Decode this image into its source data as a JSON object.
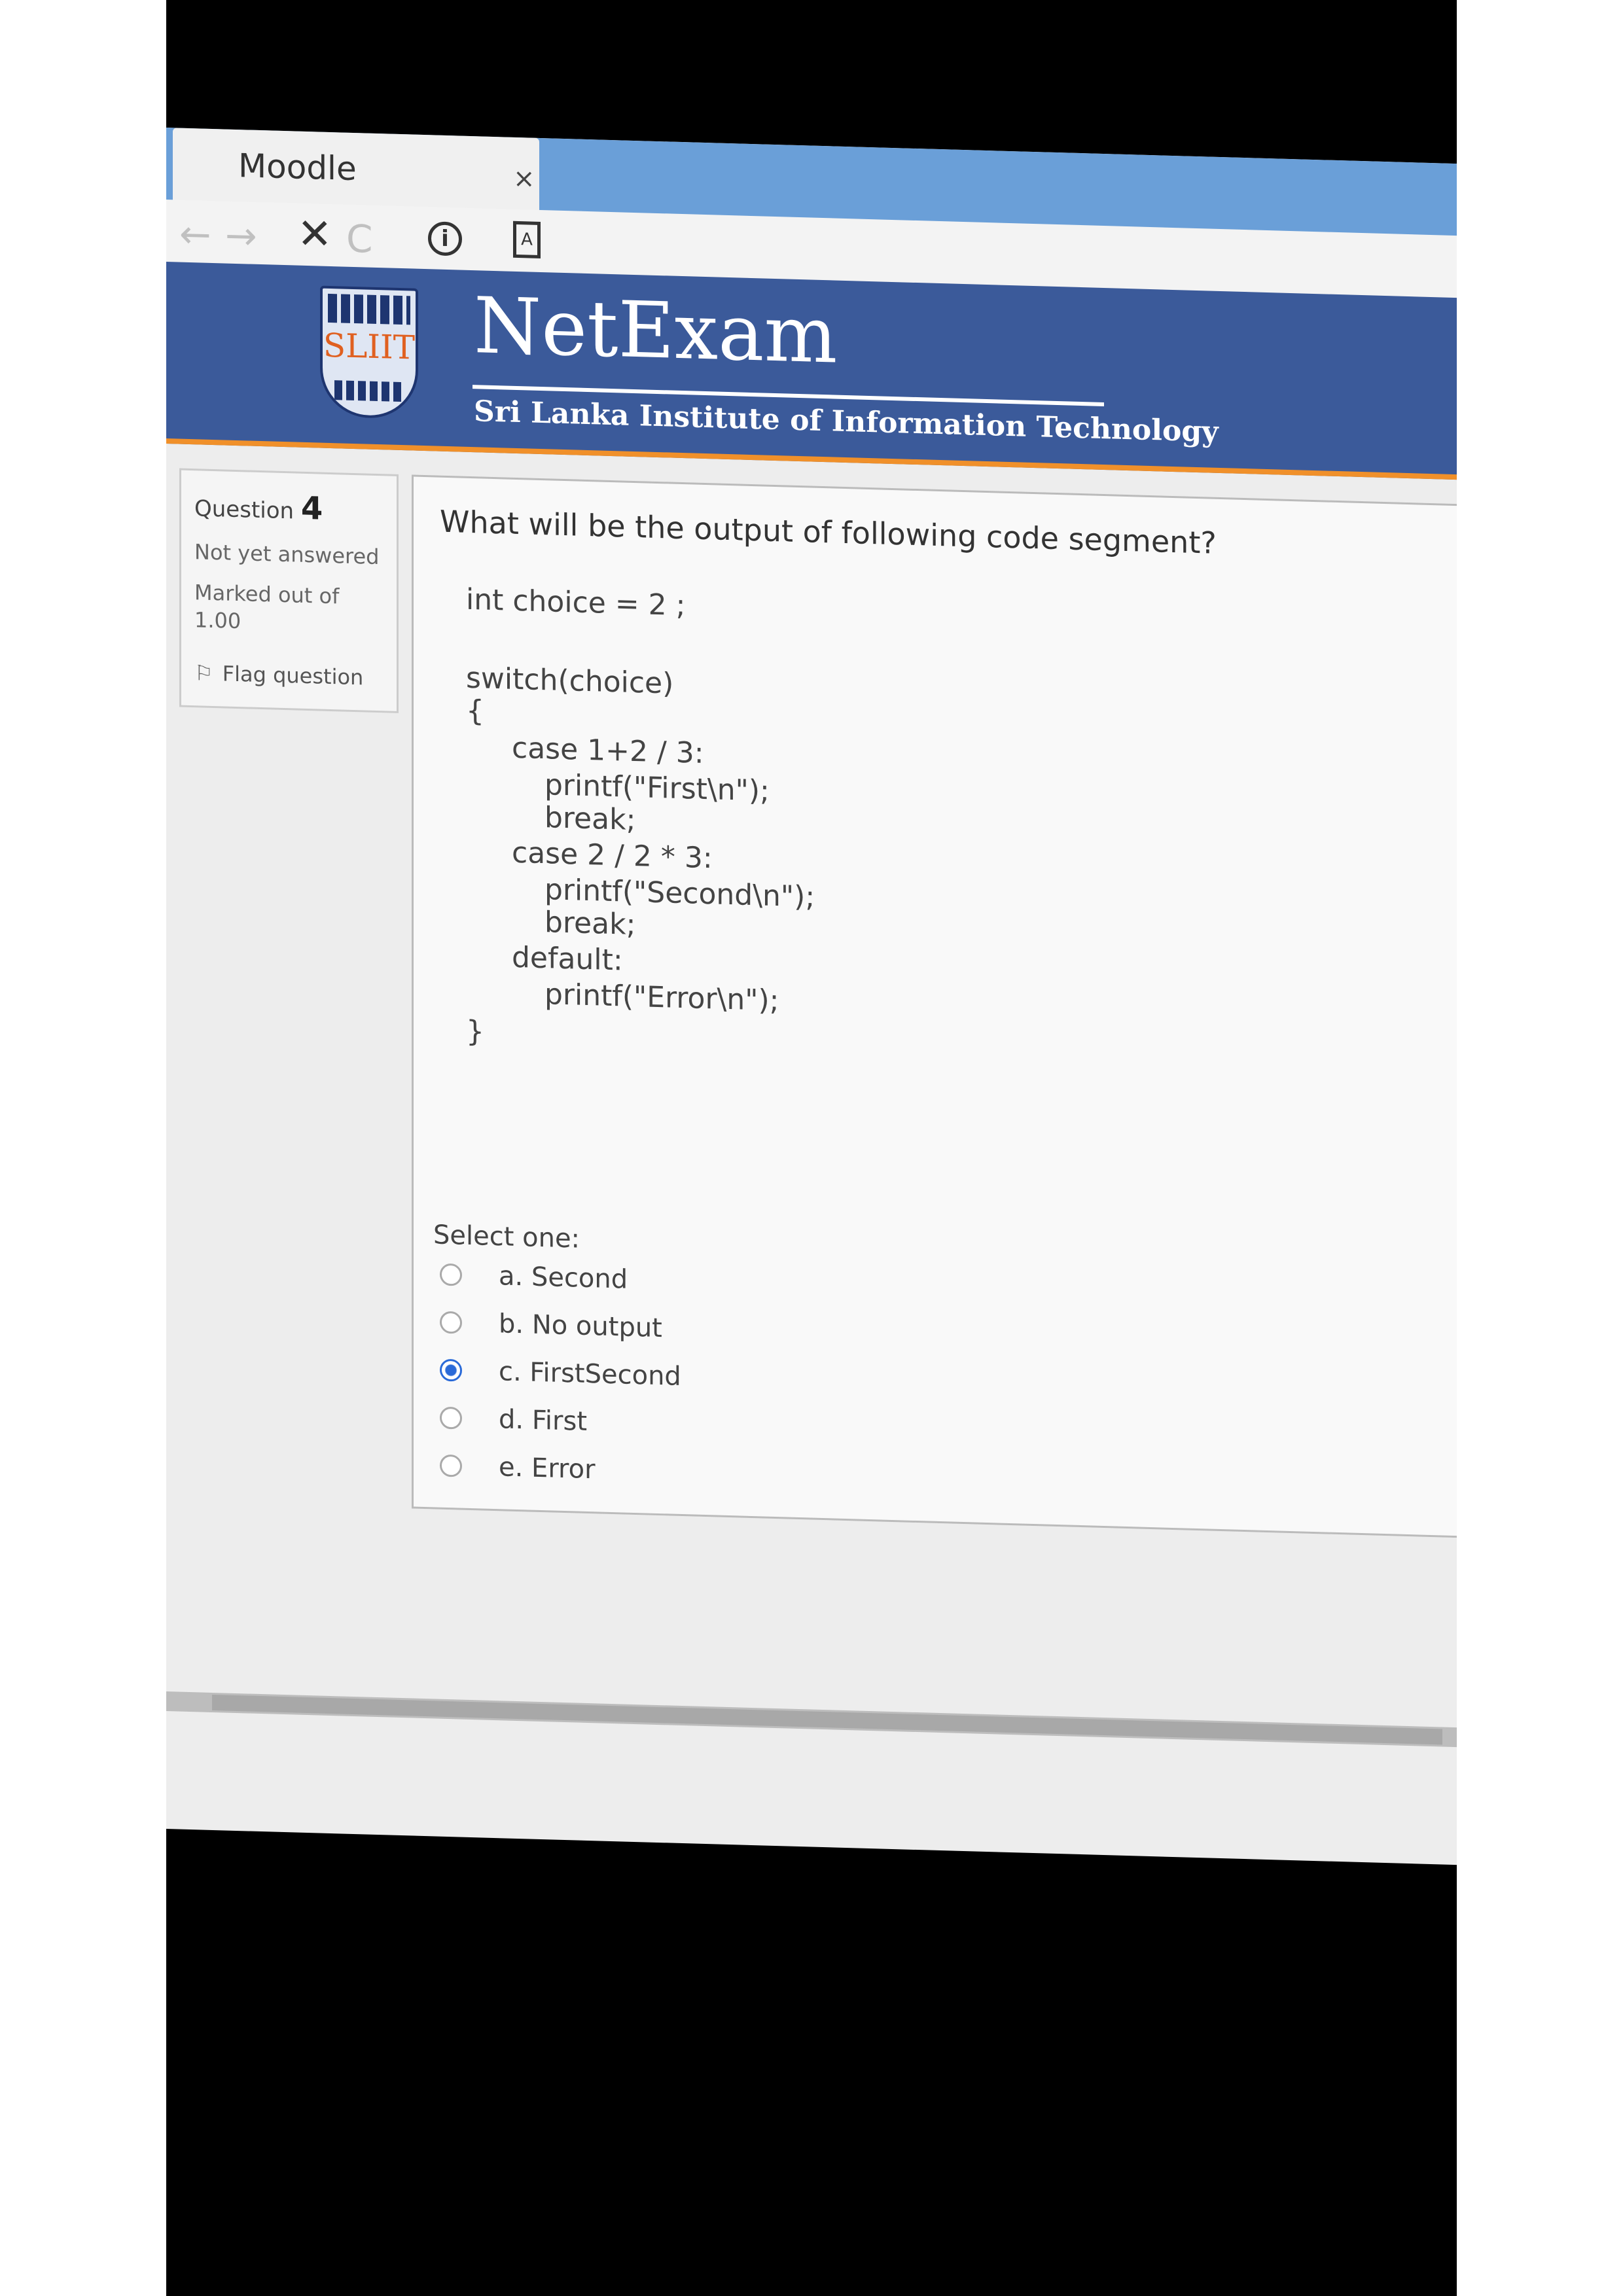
{
  "browser": {
    "tab_title": "Moodle",
    "tab_close": "×",
    "nav": {
      "back": "←",
      "forward": "→",
      "stop": "✕",
      "reload": "C"
    },
    "info_icon": "i",
    "page_icon": "A"
  },
  "header": {
    "logo_text": "SLIIT",
    "brand": "NetExam",
    "subtitle": "Sri Lanka Institute of Information Technology"
  },
  "question_info": {
    "label": "Question",
    "number": "4",
    "state": "Not yet answered",
    "mark": "Marked out of 1.00",
    "flag_label": "Flag question"
  },
  "question": {
    "text": "What will be the output of following code segment?",
    "code": [
      "int choice = 2 ;",
      "switch(choice)",
      "{",
      "case 1+2 / 3:",
      "printf(\"First\\n\");",
      "break;",
      "case 2 / 2 * 3:",
      "printf(\"Second\\n\");",
      "break;",
      "default:",
      "printf(\"Error\\n\");",
      "}"
    ],
    "select_label": "Select one:",
    "options": [
      {
        "label": "a. Second",
        "selected": false
      },
      {
        "label": "b. No output",
        "selected": false
      },
      {
        "label": "c. FirstSecond",
        "selected": true
      },
      {
        "label": "d. First",
        "selected": false
      },
      {
        "label": "e. Error",
        "selected": false
      }
    ]
  },
  "colors": {
    "header_bg": "#3b5a9a",
    "header_accent": "#f0902a",
    "radio_selected": "#2a6ad8",
    "tabbar": "#6a9fd8"
  }
}
